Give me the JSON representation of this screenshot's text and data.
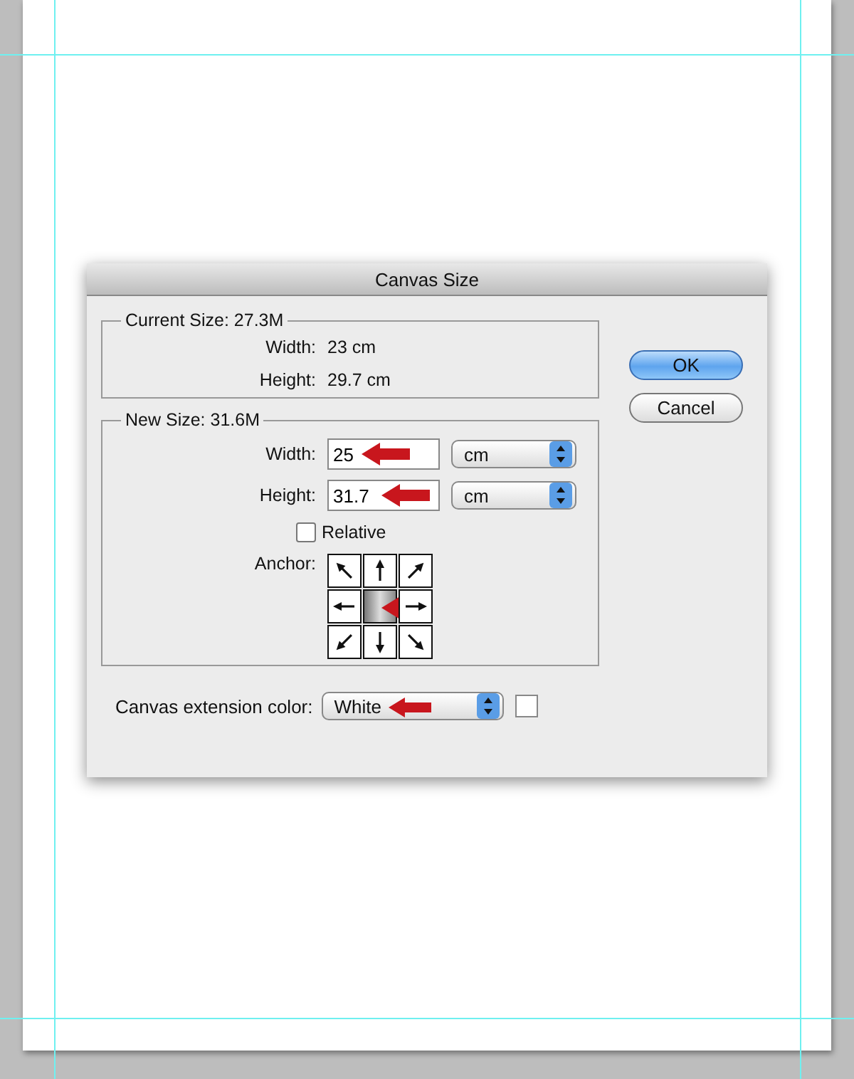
{
  "dialog": {
    "title": "Canvas Size"
  },
  "current_size": {
    "legend": "Current Size: 27.3M",
    "rows": [
      {
        "label": "Width:",
        "value": "23 cm"
      },
      {
        "label": "Height:",
        "value": "29.7 cm"
      }
    ]
  },
  "new_size": {
    "legend": "New Size: 31.6M",
    "rows": [
      {
        "label": "Width:",
        "value": "25",
        "unit": "cm"
      },
      {
        "label": "Height:",
        "value": "31.7",
        "unit": "cm"
      }
    ],
    "relative": {
      "label": "Relative",
      "checked": false
    },
    "anchor_label": "Anchor:",
    "anchor": [
      {
        "selected": false
      },
      {
        "selected": false
      },
      {
        "selected": false
      },
      {
        "selected": false
      },
      {
        "selected": true
      },
      {
        "selected": false
      },
      {
        "selected": false
      },
      {
        "selected": false
      },
      {
        "selected": false
      }
    ]
  },
  "extension": {
    "label": "Canvas extension color:",
    "value": "White"
  },
  "buttons": [
    {
      "label": "OK",
      "default": true
    },
    {
      "label": "Cancel",
      "default": false
    }
  ]
}
